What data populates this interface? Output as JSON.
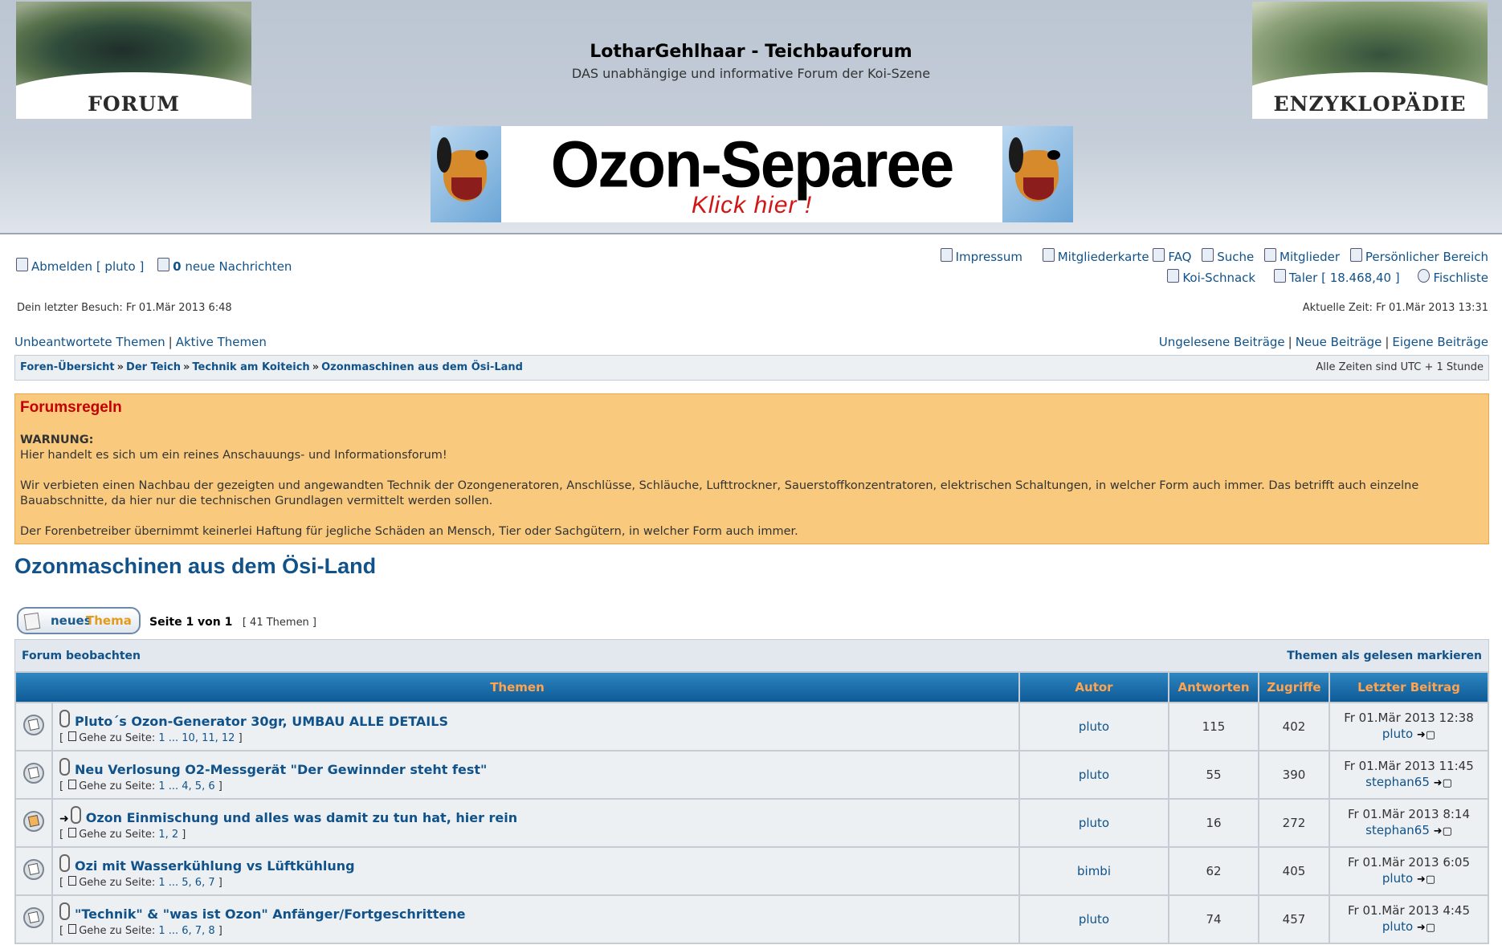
{
  "header": {
    "left_logo": "FORUM",
    "right_logo": "ENZYKLOPÄDIE",
    "site_title": "LotharGehlhaar - Teichbauforum",
    "site_desc": "DAS unabhängige und informative Forum der Koi-Szene",
    "banner_title": "Ozon-Separee",
    "banner_sub": "Klick hier !"
  },
  "user_nav": {
    "logout": "Abmelden [ pluto ]",
    "messages_count": "0",
    "messages_label": "neue Nachrichten"
  },
  "main_nav": {
    "row1": [
      "Impressum",
      "Mitgliederkarte",
      "FAQ",
      "Suche",
      "Mitglieder",
      "Persönlicher Bereich"
    ],
    "row2": [
      "Koi-Schnack",
      "Taler [ 18.468,40 ]",
      "Fischliste"
    ]
  },
  "info": {
    "last_visit": "Dein letzter Besuch: Fr 01.Mär 2013 6:48",
    "current_time": "Aktuelle Zeit: Fr 01.Mär 2013 13:31"
  },
  "quick_links": {
    "left": [
      "Unbeantwortete Themen",
      "Aktive Themen"
    ],
    "right": [
      "Ungelesene Beiträge",
      "Neue Beiträge",
      "Eigene Beiträge"
    ]
  },
  "breadcrumb": {
    "items": [
      "Foren-Übersicht",
      "Der Teich",
      "Technik am Koiteich",
      "Ozonmaschinen aus dem Ösi-Land"
    ],
    "timezone": "Alle Zeiten sind UTC + 1 Stunde"
  },
  "rules": {
    "title": "Forumsregeln",
    "warning": "WARNUNG:",
    "line1": "Hier handelt es sich um ein reines Anschauungs- und Informationsforum!",
    "line2": "Wir verbieten einen Nachbau der gezeigten und angewandten Technik der Ozongeneratoren, Anschlüsse, Schläuche, Lufttrockner, Sauerstoffkonzentratoren, elektrischen Schaltungen, in welcher Form auch immer. Das betrifft auch einzelne Bauabschnitte, da hier nur die technischen Grundlagen vermittelt werden sollen.",
    "line3": "Der Forenbetreiber übernimmt keinerlei Haftung für jegliche Schäden an Mensch, Tier oder Sachgütern, in welcher Form auch immer."
  },
  "forum_title": "Ozonmaschinen aus dem Ösi-Land",
  "toolbar": {
    "new_topic_1": "neues",
    "new_topic_2": "Thema",
    "page_info": "Seite 1 von 1",
    "topic_count": "[ 41 Themen ]"
  },
  "bar": {
    "watch": "Forum beobachten",
    "mark_read": "Themen als gelesen markieren"
  },
  "table": {
    "headers": [
      "Themen",
      "Autor",
      "Antworten",
      "Zugriffe",
      "Letzter Beitrag"
    ],
    "goto_label": "Gehe zu Seite:",
    "rows": [
      {
        "title": "Pluto´s Ozon-Generator 30gr, UMBAU ALLE DETAILS",
        "pages": "1 ... 10, 11, 12",
        "author": "pluto",
        "replies": "115",
        "views": "402",
        "last_date": "Fr 01.Mär 2013 12:38",
        "last_user": "pluto",
        "new": false
      },
      {
        "title": "Neu Verlosung O2-Messgerät \"Der Gewinnder steht fest\"",
        "pages": "1 ... 4, 5, 6",
        "author": "pluto",
        "replies": "55",
        "views": "390",
        "last_date": "Fr 01.Mär 2013 11:45",
        "last_user": "stephan65",
        "new": false
      },
      {
        "title": "Ozon Einmischung und alles was damit zu tun hat, hier rein",
        "pages": "1, 2",
        "author": "pluto",
        "replies": "16",
        "views": "272",
        "last_date": "Fr 01.Mär 2013 8:14",
        "last_user": "stephan65",
        "new": true
      },
      {
        "title": "Ozi mit Wasserkühlung vs Lüftkühlung",
        "pages": "1 ... 5, 6, 7",
        "author": "bimbi",
        "replies": "62",
        "views": "405",
        "last_date": "Fr 01.Mär 2013 6:05",
        "last_user": "pluto",
        "new": false
      },
      {
        "title": "\"Technik\" & \"was ist Ozon\" Anfänger/Fortgeschrittene",
        "pages": "1 ... 6, 7, 8",
        "author": "pluto",
        "replies": "74",
        "views": "457",
        "last_date": "Fr 01.Mär 2013 4:45",
        "last_user": "pluto",
        "new": false
      }
    ]
  }
}
